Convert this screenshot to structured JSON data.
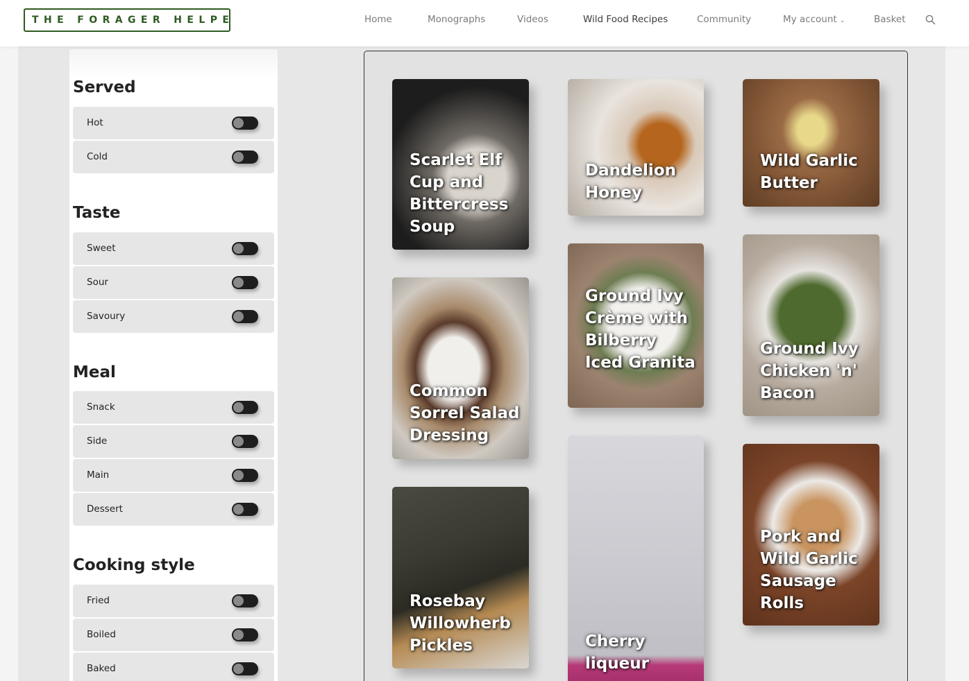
{
  "header": {
    "logo_text": "THE FORAGER HELPER",
    "nav": {
      "home": "Home",
      "monographs": "Monographs",
      "videos": "Videos",
      "recipes": "Wild Food Recipes",
      "community": "Community",
      "account": "My account",
      "basket": "Basket"
    }
  },
  "filters": {
    "served": {
      "title": "Served",
      "options": [
        "Hot",
        "Cold"
      ]
    },
    "taste": {
      "title": "Taste",
      "options": [
        "Sweet",
        "Sour",
        "Savoury"
      ]
    },
    "meal": {
      "title": "Meal",
      "options": [
        "Snack",
        "Side",
        "Main",
        "Dessert"
      ]
    },
    "cooking": {
      "title": "Cooking style",
      "options": [
        "Fried",
        "Boiled",
        "Baked"
      ]
    }
  },
  "recipes": [
    {
      "title": "Scarlet Elf Cup and Bittercress Soup",
      "bg": "#2b2b2b"
    },
    {
      "title": "Dandelion Honey",
      "bg": "#c9c1b6"
    },
    {
      "title": "Wild Garlic Butter",
      "bg": "#8a5c3a"
    },
    {
      "title": "Common Sorrel Salad Dressing",
      "bg": "#7a6a58"
    },
    {
      "title": "Ground Ivy Crème with Bilberry Iced Granita",
      "bg": "#8d7763"
    },
    {
      "title": "Ground Ivy Chicken 'n' Bacon",
      "bg": "#9b8e80"
    },
    {
      "title": "Rosebay Willowherb Pickles",
      "bg": "#6a5f52"
    },
    {
      "title": "Cherry liqueur",
      "bg": "#bdbdc4"
    },
    {
      "title": "Pork and Wild Garlic Sausage Rolls",
      "bg": "#6b3a22"
    }
  ]
}
